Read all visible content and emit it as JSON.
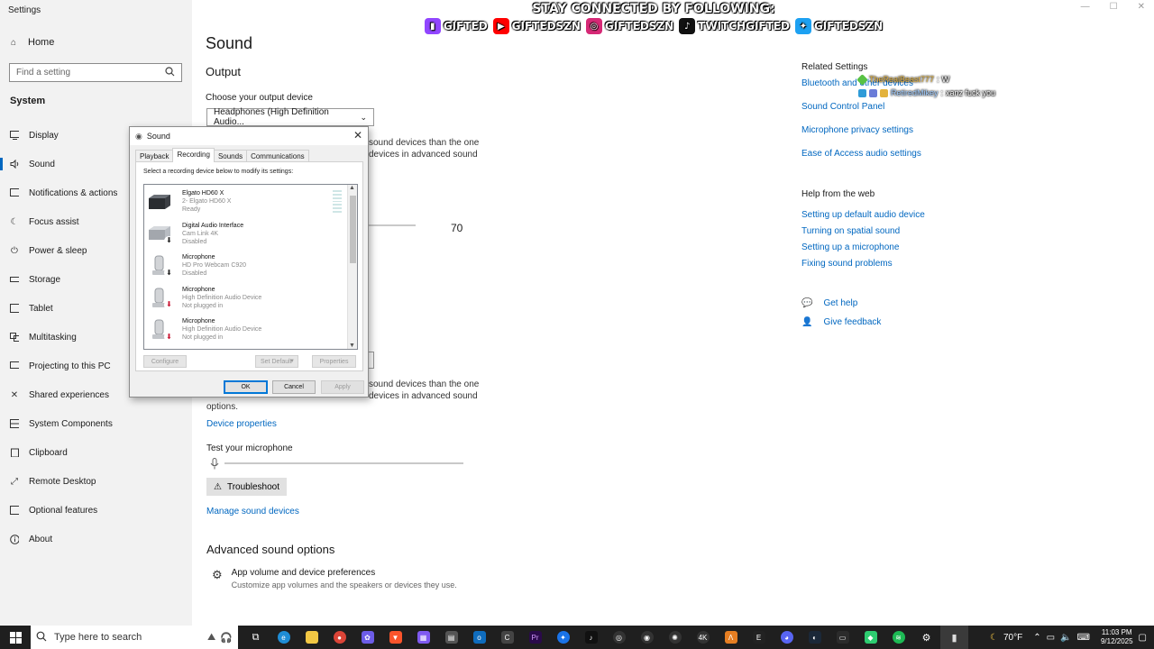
{
  "app_title": "Settings",
  "sidebar": {
    "home": "Home",
    "search_placeholder": "Find a setting",
    "section": "System",
    "items": [
      {
        "label": "Display",
        "icon": "display-icon"
      },
      {
        "label": "Sound",
        "icon": "speaker-icon",
        "active": true
      },
      {
        "label": "Notifications & actions",
        "icon": "notifications-icon"
      },
      {
        "label": "Focus assist",
        "icon": "moon-icon"
      },
      {
        "label": "Power & sleep",
        "icon": "power-icon"
      },
      {
        "label": "Storage",
        "icon": "storage-icon"
      },
      {
        "label": "Tablet",
        "icon": "tablet-icon"
      },
      {
        "label": "Multitasking",
        "icon": "multitasking-icon"
      },
      {
        "label": "Projecting to this PC",
        "icon": "projecting-icon"
      },
      {
        "label": "Shared experiences",
        "icon": "shared-icon"
      },
      {
        "label": "System Components",
        "icon": "components-icon"
      },
      {
        "label": "Clipboard",
        "icon": "clipboard-icon"
      },
      {
        "label": "Remote Desktop",
        "icon": "remote-icon"
      },
      {
        "label": "Optional features",
        "icon": "optional-icon"
      },
      {
        "label": "About",
        "icon": "info-icon"
      }
    ]
  },
  "main": {
    "title": "Sound",
    "output_heading": "Output",
    "output_device_label": "Choose your output device",
    "output_device_value": "Headphones (High Definition Audio...",
    "hint_line1": "sound devices than the one",
    "hint_line2": "devices in advanced sound",
    "volume_value": "70",
    "input_hint_line1": "sound devices than the one",
    "input_hint_line2": "devices in advanced sound",
    "input_hint_line3": "options.",
    "device_properties": "Device properties",
    "test_mic_label": "Test your microphone",
    "troubleshoot": "Troubleshoot",
    "manage_sound_devices": "Manage sound devices",
    "advanced_heading": "Advanced sound options",
    "app_volume_title": "App volume and device preferences",
    "app_volume_desc": "Customize app volumes and the speakers or devices they use."
  },
  "related": {
    "heading": "Related Settings",
    "links": [
      "Bluetooth and other devices",
      "Sound Control Panel",
      "Microphone privacy settings",
      "Ease of Access audio settings"
    ]
  },
  "help": {
    "heading": "Help from the web",
    "links": [
      "Setting up default audio device",
      "Turning on spatial sound",
      "Setting up a microphone",
      "Fixing sound problems"
    ],
    "get_help": "Get help",
    "give_feedback": "Give feedback"
  },
  "overlay": {
    "title": "STAY CONNECTED BY FOLLOWING:",
    "socials": [
      {
        "name": "GIFTED",
        "icon": "twitch-icon",
        "color": "#9146ff"
      },
      {
        "name": "GIFTEDSZN",
        "icon": "youtube-icon",
        "color": "#ff0000"
      },
      {
        "name": "GIFTEDSZN",
        "icon": "instagram-icon",
        "color": "#d62976"
      },
      {
        "name": "TWITCHGIFTED",
        "icon": "tiktok-icon",
        "color": "#111111"
      },
      {
        "name": "GIFTEDSZN",
        "icon": "twitter-icon",
        "color": "#1da1f2"
      }
    ],
    "chat": [
      {
        "user": "TheRealBeast777",
        "sep": " : ",
        "msg": "W"
      },
      {
        "user": "RetiredMikey",
        "sep": " : ",
        "msg": "xanz fuck you"
      }
    ]
  },
  "dialog": {
    "title": "Sound",
    "tabs": [
      "Playback",
      "Recording",
      "Sounds",
      "Communications"
    ],
    "active_tab": "Recording",
    "instruction": "Select a recording device below to modify its settings:",
    "devices": [
      {
        "name": "Elgato HD60 X",
        "sub": "2- Elgato HD60 X",
        "status": "Ready",
        "icon": "capture-card-icon"
      },
      {
        "name": "Digital Audio Interface",
        "sub": "Cam Link 4K",
        "status": "Disabled",
        "icon": "audio-interface-icon"
      },
      {
        "name": "Microphone",
        "sub": "HD Pro Webcam C920",
        "status": "Disabled",
        "icon": "microphone-icon"
      },
      {
        "name": "Microphone",
        "sub": "High Definition Audio Device",
        "status": "Not plugged in",
        "icon": "microphone-icon"
      },
      {
        "name": "Microphone",
        "sub": "High Definition Audio Device",
        "status": "Not plugged in",
        "icon": "microphone-icon"
      }
    ],
    "buttons": {
      "configure": "Configure",
      "set_default": "Set Default",
      "properties": "Properties",
      "ok": "OK",
      "cancel": "Cancel",
      "apply": "Apply"
    }
  },
  "taskbar": {
    "search_placeholder": "Type here to search",
    "weather": "70°F",
    "time": "11:03 PM",
    "date": "9/12/2025"
  },
  "colors": {
    "accent": "#0067c0",
    "taskbar": "#1f1f1f",
    "sidebar": "#f2f2f2"
  }
}
